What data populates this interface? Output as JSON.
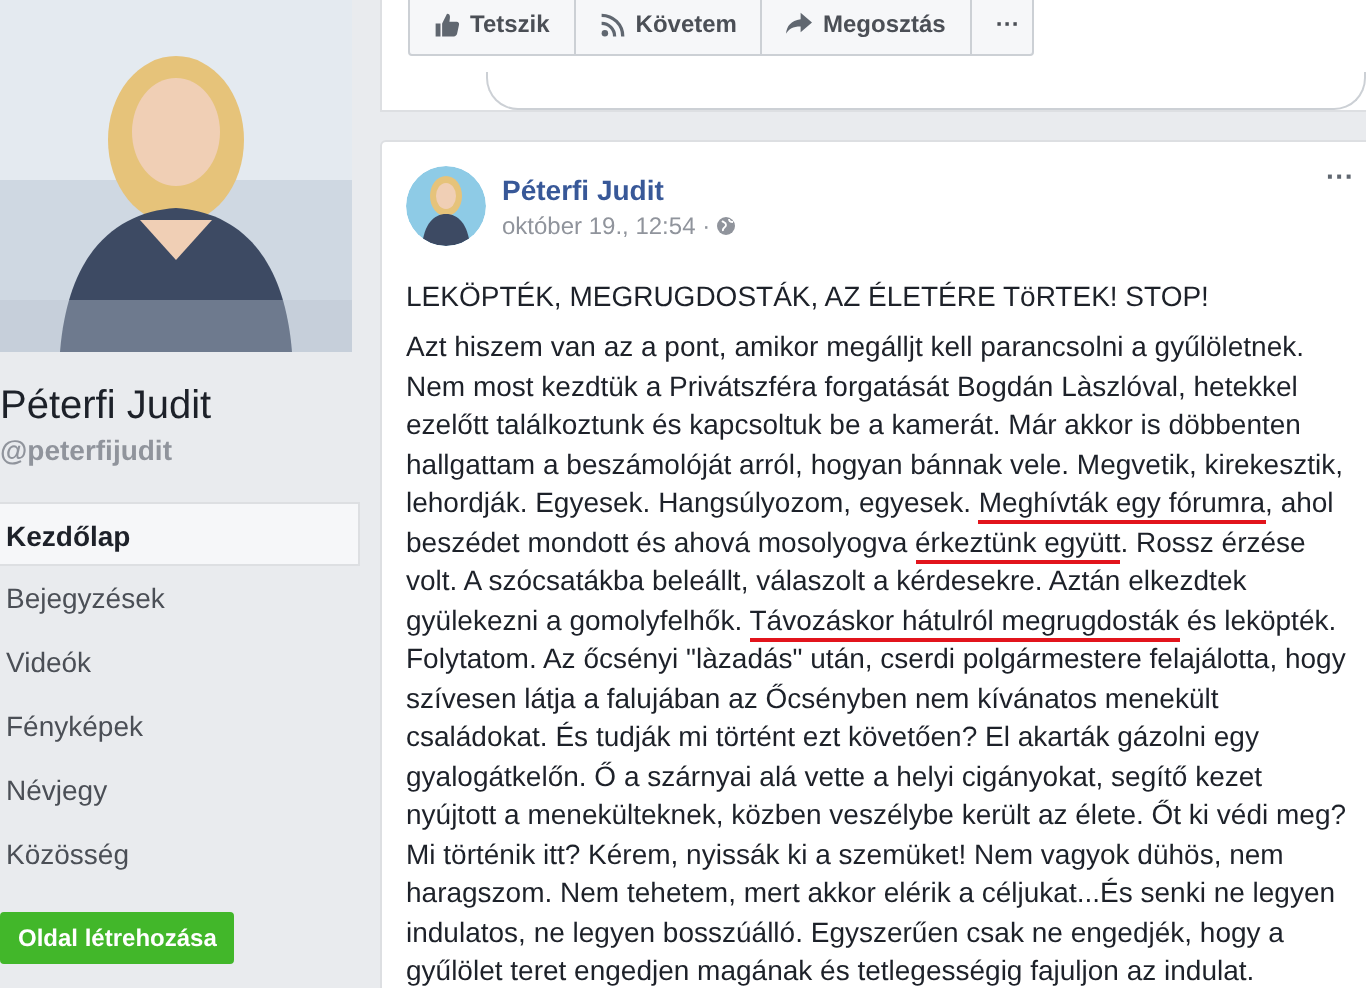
{
  "profile": {
    "name": "Péterfi Judit",
    "handle": "@peterfijudit"
  },
  "nav": [
    {
      "label": "Kezdőlap",
      "selected": true
    },
    {
      "label": "Bejegyzések",
      "selected": false
    },
    {
      "label": "Videók",
      "selected": false
    },
    {
      "label": "Fényképek",
      "selected": false
    },
    {
      "label": "Névjegy",
      "selected": false
    },
    {
      "label": "Közösség",
      "selected": false
    }
  ],
  "create_page_button": "Oldal létrehozása",
  "previous_post": {
    "actions": [
      {
        "kind": "like",
        "label": "Tetszik"
      },
      {
        "kind": "follow",
        "label": "Követem"
      },
      {
        "kind": "share",
        "label": "Megosztás"
      },
      {
        "kind": "more",
        "label": "···"
      }
    ]
  },
  "post": {
    "author": "Péterfi Judit",
    "date": "október 19., 12:54 ·",
    "more": "···",
    "headline": "LEKÖPTÉK, MEGRUGDOSTÁK, AZ ÉLETÉRE TöRTEK! STOP!",
    "body": [
      {
        "text": "Azt hiszem van az a pont, amikor megálljt kell parancsolni a gyűlöletnek. Nem most kezdtük a Privátszféra forgatását Bogdán Làszlóval, hetekkel ezelőtt találkoztunk és kapcsoltuk be a kamerát. Már akkor is döbbenten hallgattam a beszámolóját arról, hogyan bánnak vele. Megvetik, kirekesztik, lehordják. Egyesek. Hangsúlyozom, egyesek. ",
        "underlined": false
      },
      {
        "text": "Meghívták egy fórumra",
        "underlined": true
      },
      {
        "text": ", ahol beszédet mondott és ahová mosolyogva ",
        "underlined": false
      },
      {
        "text": "érkeztünk együtt",
        "underlined": true
      },
      {
        "text": ". Rossz érzése volt. A szócsatákba beleállt, válaszolt a kérdesekre. Aztán elkezdtek gyülekezni a gomolyfelhők. ",
        "underlined": false
      },
      {
        "text": "Távozáskor hátulról megrugdosták",
        "underlined": true
      },
      {
        "text": " és leköpték. Folytatom. Az őcsényi \"làzadás\" után, cserdi polgármestere felajálotta, hogy szívesen látja a falujában az Őcsényben nem kívánatos menekült családokat. És tudják mi történt ezt követően? El akarták gázolni egy gyalogátkelőn. Ő a szárnyai alá vette a helyi cigányokat, segítő kezet nyújtott a menekülteknek, közben veszélybe került az élete. Őt ki védi meg? Mi történik itt? Kérem, nyissák ki a szemüket! Nem vagyok dühös, nem haragszom. Nem tehetem, mert akkor elérik a céljukat...És senki ne legyen indulatos, ne legyen bosszúálló. Egyszerűen csak ne engedjék, hogy a gyűlölet teret engedjen magának és tetlegességig fajuljon az indulat.",
        "underlined": false
      }
    ]
  }
}
